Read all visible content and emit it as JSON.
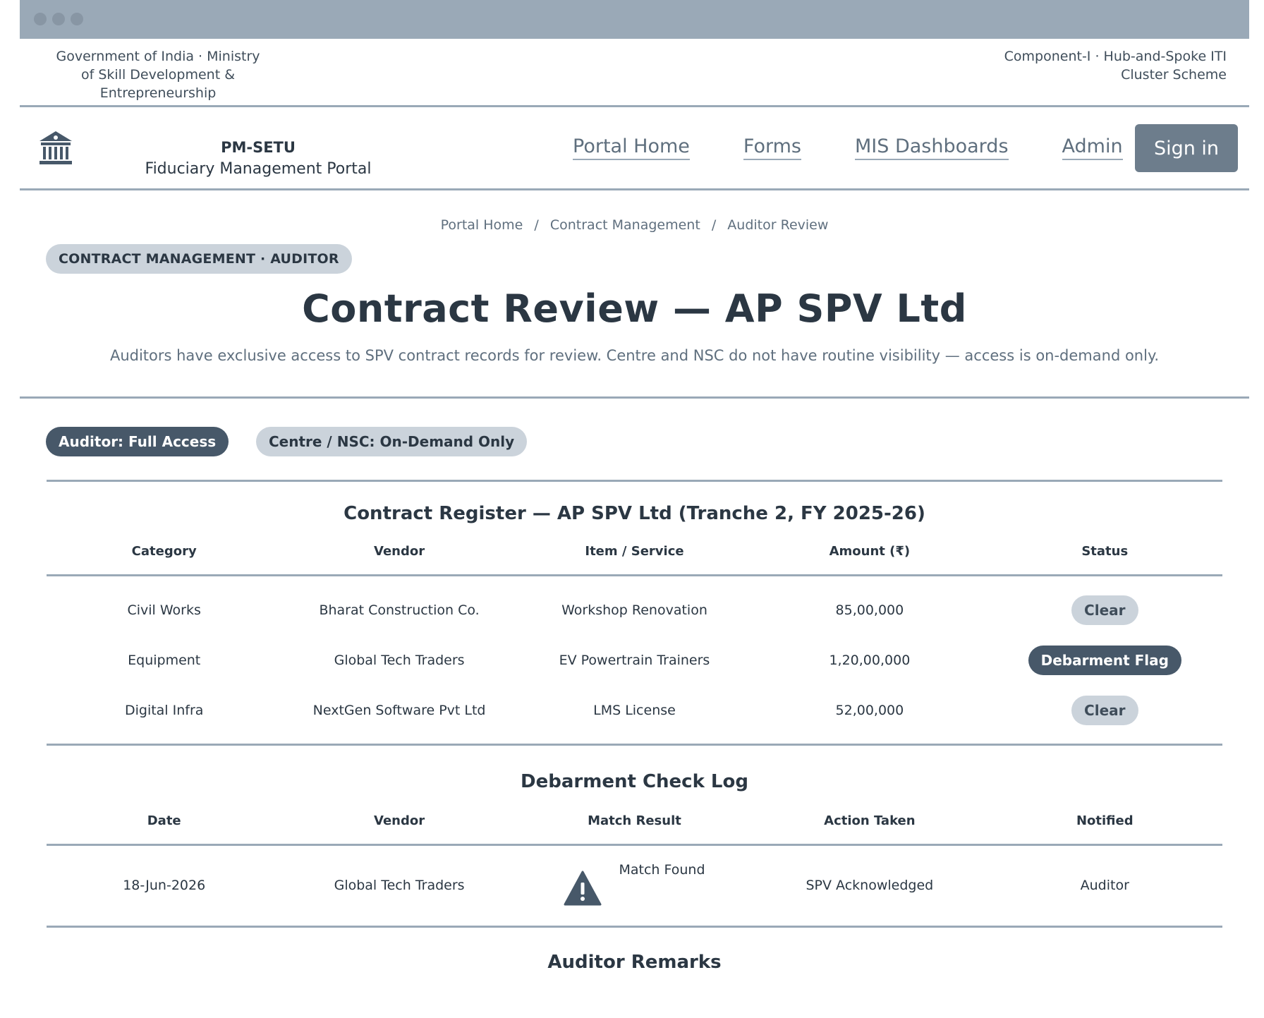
{
  "gov": {
    "left_text": "Government of India · Ministry of Skill Development & Entrepreneurship",
    "right_text": "Component-I · Hub-and-Spoke ITI Cluster Scheme"
  },
  "brand": {
    "title": "PM-SETU",
    "subtitle": "Fiduciary Management Portal",
    "logo_icon": "institution-building-icon"
  },
  "nav": {
    "links": [
      "Portal Home",
      "Forms",
      "MIS Dashboards",
      "Admin"
    ],
    "signin_label": "Sign in"
  },
  "breadcrumb": [
    "Portal Home",
    "Contract Management",
    "Auditor Review"
  ],
  "breadcrumb_sep": "/",
  "hero": {
    "tag": "CONTRACT MANAGEMENT · AUDITOR",
    "title": "Contract Review — AP SPV Ltd",
    "description": "Auditors have exclusive access to SPV contract records for review. Centre and NSC do not have routine visibility — access is on-demand only."
  },
  "access": {
    "auditor": "Auditor: Full Access",
    "centre": "Centre / NSC: On-Demand Only"
  },
  "contracts": {
    "title": "Contract Register — AP SPV Ltd (Tranche 2, FY 2025-26)",
    "headers": [
      "Category",
      "Vendor",
      "Item / Service",
      "Amount (₹)",
      "Status"
    ],
    "rows": [
      {
        "category": "Civil Works",
        "vendor": "Bharat Construction Co.",
        "item": "Workshop Renovation",
        "amount": "85,00,000",
        "status": "Clear"
      },
      {
        "category": "Equipment",
        "vendor": "Global Tech Traders",
        "item": "EV Powertrain Trainers",
        "amount": "1,20,00,000",
        "status": "Debarment Flag"
      },
      {
        "category": "Digital Infra",
        "vendor": "NextGen Software Pvt Ltd",
        "item": "LMS License",
        "amount": "52,00,000",
        "status": "Clear"
      }
    ]
  },
  "debarment": {
    "title": "Debarment Check Log",
    "headers": [
      "Date",
      "Vendor",
      "Match Result",
      "Action Taken",
      "Notified"
    ],
    "rows": [
      {
        "date": "18-Jun-2026",
        "vendor": "Global Tech Traders",
        "result": "Match Found",
        "result_icon": "warning-icon",
        "action": "SPV Acknowledged",
        "notified": "Auditor"
      }
    ]
  },
  "remarks": {
    "title": "Auditor Remarks"
  },
  "colors": {
    "accent_dark": "#475869",
    "accent_light": "#cbd3db",
    "rule": "#9aa9b7",
    "text": "#2b3743"
  }
}
